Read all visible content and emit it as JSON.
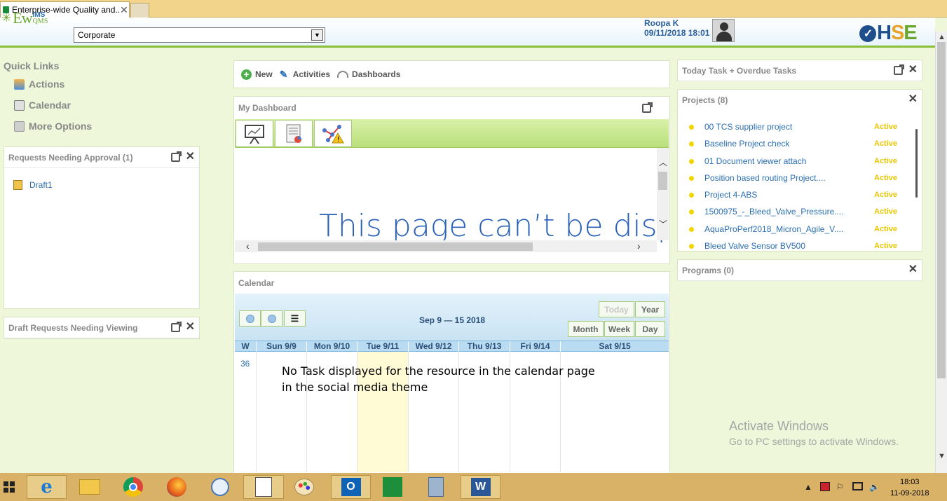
{
  "browser": {
    "tab_title": "Enterprise-wide Quality and...",
    "tab_close": "✕"
  },
  "header": {
    "logo_ew": "Ew",
    "logo_ims": "IMS",
    "logo_qms": "QMS",
    "org_select_value": "Corporate",
    "user_name": "Roopa K",
    "login_time": "09/11/2018 18:01",
    "brand": {
      "h": "H",
      "s": "S",
      "e": "E"
    }
  },
  "quick_links": {
    "title": "Quick Links",
    "items": [
      {
        "label": "Actions",
        "icon": "user-actions-icon"
      },
      {
        "label": "Calendar",
        "icon": "calendar-icon"
      },
      {
        "label": "More Options",
        "icon": "more-options-icon"
      }
    ]
  },
  "requests_approval": {
    "title": "Requests Needing Approval (1)",
    "items": [
      {
        "label": "Draft1"
      }
    ]
  },
  "draft_requests": {
    "title": "Draft Requests Needing Viewing"
  },
  "toolbar": {
    "new": "New",
    "activities": "Activities",
    "dashboards": "Dashboards"
  },
  "dashboard": {
    "title": "My Dashboard",
    "error_text": "This page can’t be disp"
  },
  "calendar": {
    "title": "Calendar",
    "range": "Sep 9 — 15 2018",
    "buttons": {
      "today": "Today",
      "year": "Year",
      "month": "Month",
      "week": "Week",
      "day": "Day"
    },
    "columns": [
      "W",
      "Sun 9/9",
      "Mon 9/10",
      "Tue 9/11",
      "Wed 9/12",
      "Thu 9/13",
      "Fri 9/14",
      "Sat 9/15"
    ],
    "week_number": "36",
    "highlight_color": "#fffbd5"
  },
  "annotation": "No Task displayed for the resource in the calendar page in the social media theme",
  "today_tasks": {
    "title": "Today Task + Overdue Tasks"
  },
  "projects": {
    "title": "Projects (8)",
    "items": [
      {
        "name": "00 TCS supplier project",
        "status": "Active"
      },
      {
        "name": "Baseline Project check",
        "status": "Active"
      },
      {
        "name": "01 Document viewer attach",
        "status": "Active"
      },
      {
        "name": "Position based routing Project....",
        "status": "Active"
      },
      {
        "name": "Project 4-ABS",
        "status": "Active"
      },
      {
        "name": "1500975_-_Bleed_Valve_Pressure....",
        "status": "Active"
      },
      {
        "name": "AquaProPerf2018_Micron_Agile_V....",
        "status": "Active"
      },
      {
        "name": "Bleed Valve Sensor BV500",
        "status": "Active"
      }
    ]
  },
  "programs": {
    "title": "Programs (0)"
  },
  "watermark": {
    "line1": "Activate Windows",
    "line2": "Go to PC settings to activate Windows."
  },
  "taskbar": {
    "time": "18:03",
    "date": "11-09-2018"
  }
}
